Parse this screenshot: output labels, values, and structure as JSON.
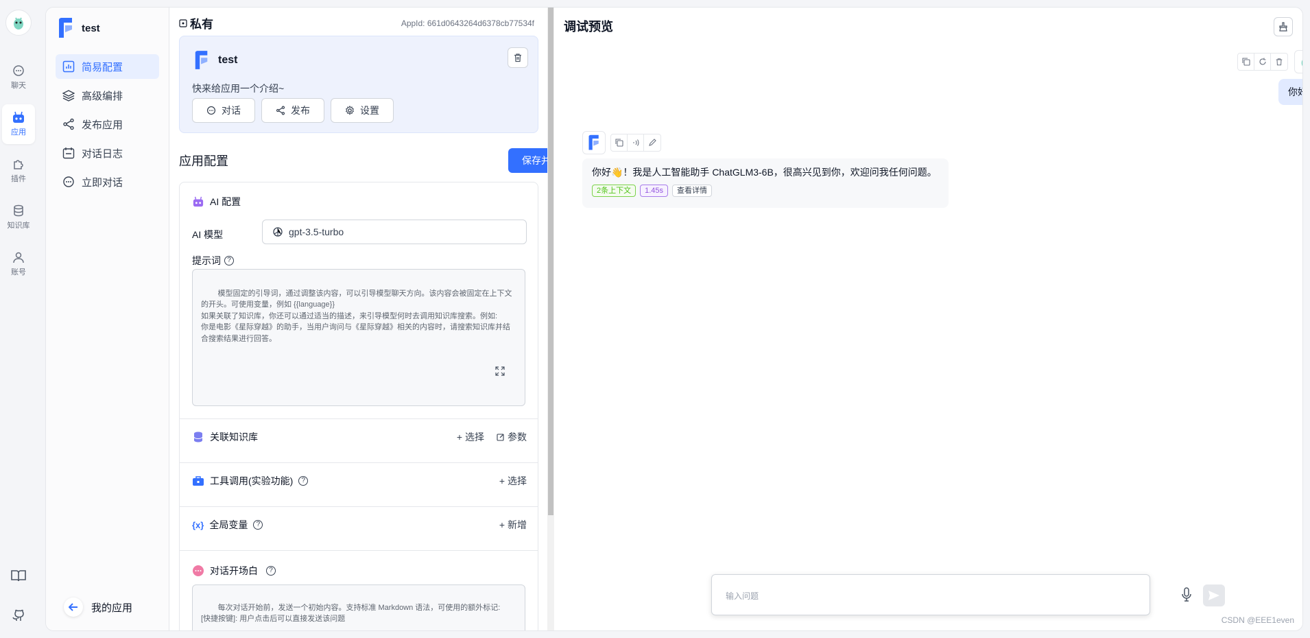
{
  "rail": {
    "items": [
      {
        "label": "聊天",
        "icon": "chat-icon"
      },
      {
        "label": "应用",
        "icon": "robot-icon",
        "active": true
      },
      {
        "label": "插件",
        "icon": "puzzle-icon"
      },
      {
        "label": "知识库",
        "icon": "database-icon"
      },
      {
        "label": "账号",
        "icon": "user-icon"
      }
    ],
    "bottom_icons": [
      "book-icon",
      "github-icon"
    ]
  },
  "appnav": {
    "app_name": "test",
    "items": [
      {
        "label": "简易配置",
        "icon": "chart-icon",
        "active": true
      },
      {
        "label": "高级编排",
        "icon": "layers-icon"
      },
      {
        "label": "发布应用",
        "icon": "share-icon"
      },
      {
        "label": "对话日志",
        "icon": "calendar-icon"
      },
      {
        "label": "立即对话",
        "icon": "chat-icon"
      }
    ],
    "back_label": "我的应用"
  },
  "config": {
    "visibility": "私有",
    "app_id": "AppId: 661d0643264d6378cb77534f",
    "app_title": "test",
    "intro": "快来给应用一个介绍~",
    "actions": [
      {
        "label": "对话",
        "icon": "chat-icon"
      },
      {
        "label": "发布",
        "icon": "share-icon"
      },
      {
        "label": "设置",
        "icon": "gear-icon"
      }
    ],
    "section_title": "应用配置",
    "save_label": "保存并预览",
    "ai_config_label": "AI 配置",
    "model_label": "AI 模型",
    "model_value": "gpt-3.5-turbo",
    "prompt_label": "提示词",
    "prompt_placeholder": "模型固定的引导词，通过调整该内容，可以引导模型聊天方向。该内容会被固定在上下文的开头。可使用变量，例如 {{language}}\n如果关联了知识库，你还可以通过适当的描述，来引导模型何时去调用知识库搜索。例如:\n你是电影《星际穿越》的助手，当用户询问与《星际穿越》相关的内容时，请搜索知识库并结合搜索结果进行回答。",
    "kb_label": "关联知识库",
    "kb_select": "选择",
    "kb_params": "参数",
    "tools_label": "工具调用(实验功能)",
    "tools_select": "选择",
    "vars_label": "全局变量",
    "vars_add": "新增",
    "opener_label": "对话开场白",
    "opener_placeholder": "每次对话开始前，发送一个初始内容。支持标准 Markdown 语法，可使用的额外标记:\n[快捷按键]: 用户点击后可以直接发送该问题"
  },
  "preview": {
    "title": "调试预览",
    "user_message": "你好",
    "bot_message": "你好👋！我是人工智能助手 ChatGLM3-6B，很高兴见到你，欢迎问我任何问题。",
    "tags": [
      "2条上下文",
      "1.45s",
      "查看详情"
    ],
    "input_placeholder": "输入问题",
    "watermark": "CSDN @EEE1even"
  },
  "colors": {
    "accent": "#3370ff",
    "user_bubble": "#e1eaff"
  }
}
